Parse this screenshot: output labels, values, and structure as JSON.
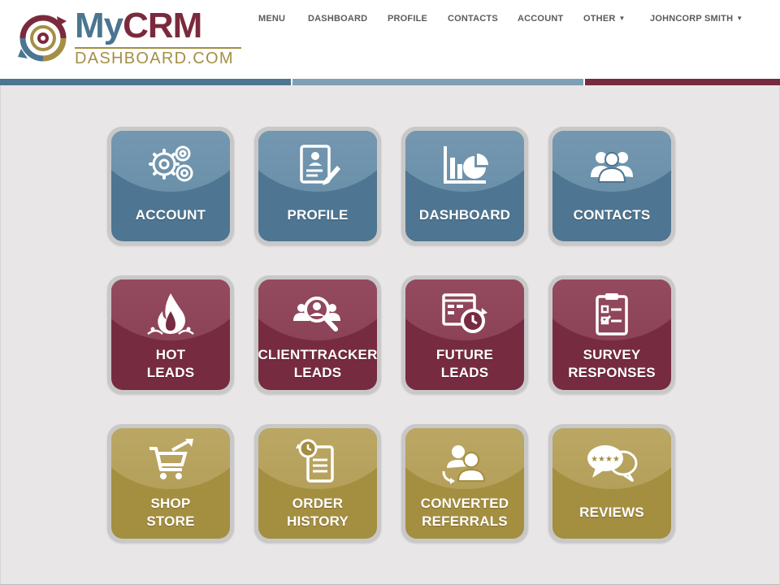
{
  "window_title": "",
  "brand": {
    "name_part1": "My",
    "name_part2": "CRM",
    "tagline": "DASHBOARD.COM"
  },
  "nav": {
    "items": [
      {
        "label": "MENU",
        "dropdown": false
      },
      {
        "label": "DASHBOARD",
        "dropdown": false
      },
      {
        "label": "PROFILE",
        "dropdown": false
      },
      {
        "label": "CONTACTS",
        "dropdown": false
      },
      {
        "label": "ACCOUNT",
        "dropdown": false
      },
      {
        "label": "OTHER",
        "dropdown": true
      },
      {
        "label": "JOHNCORP SMITH",
        "dropdown": true
      }
    ]
  },
  "colors": {
    "blue": "#4e7591",
    "blue_light": "#7f9fb3",
    "maroon": "#762b40",
    "gold": "#a48e40",
    "tile_frame": "#c9c8c8",
    "background": "#e8e6e7"
  },
  "tiles": [
    {
      "line1": "ACCOUNT",
      "line2": "",
      "theme": "blue",
      "icon": "gears-icon"
    },
    {
      "line1": "PROFILE",
      "line2": "",
      "theme": "blue",
      "icon": "profile-edit-icon"
    },
    {
      "line1": "DASHBOARD",
      "line2": "",
      "theme": "blue",
      "icon": "bar-pie-chart-icon"
    },
    {
      "line1": "CONTACTS",
      "line2": "",
      "theme": "blue",
      "icon": "people-group-icon"
    },
    {
      "line1": "HOT",
      "line2": "LEADS",
      "theme": "maroon",
      "icon": "flame-icon"
    },
    {
      "line1": "CLIENTTRACKER",
      "line2": "LEADS",
      "theme": "maroon",
      "icon": "magnify-person-icon"
    },
    {
      "line1": "FUTURE",
      "line2": "LEADS",
      "theme": "maroon",
      "icon": "calendar-clock-icon"
    },
    {
      "line1": "SURVEY",
      "line2": "RESPONSES",
      "theme": "maroon",
      "icon": "clipboard-checklist-icon"
    },
    {
      "line1": "SHOP",
      "line2": "STORE",
      "theme": "gold",
      "icon": "shopping-cart-icon"
    },
    {
      "line1": "ORDER",
      "line2": "HISTORY",
      "theme": "gold",
      "icon": "document-history-icon"
    },
    {
      "line1": "CONVERTED",
      "line2": "REFERRALS",
      "theme": "gold",
      "icon": "people-exchange-icon"
    },
    {
      "line1": "REVIEWS",
      "line2": "",
      "theme": "gold",
      "icon": "review-speech-icon"
    }
  ]
}
